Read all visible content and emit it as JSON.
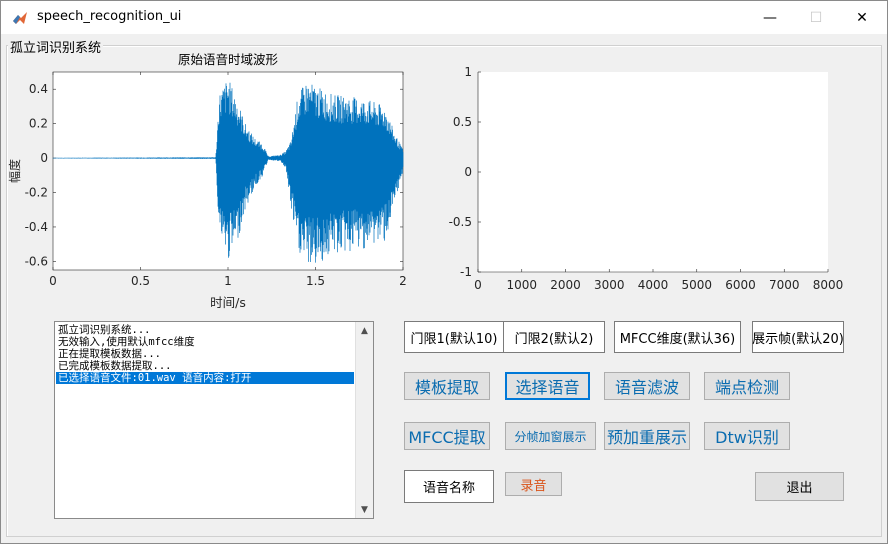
{
  "window": {
    "title": "speech_recognition_ui",
    "controls": {
      "minimize": "—",
      "maximize": "☐",
      "close": "✕"
    }
  },
  "panel": {
    "title": "孤立词识别系统"
  },
  "left_plot": {
    "title": "原始语音时域波形",
    "xlabel": "时间/s",
    "ylabel": "幅度"
  },
  "chart_data": [
    {
      "type": "line",
      "title": "原始语音时域波形",
      "xlabel": "时间/s",
      "ylabel": "幅度",
      "xlim": [
        0,
        2
      ],
      "ylim": [
        -0.65,
        0.5
      ],
      "xticks": [
        "0",
        "0.5",
        "1",
        "1.5",
        "2"
      ],
      "yticks": [
        "0.4",
        "0.2",
        "0",
        "-0.2",
        "-0.4",
        "-0.6"
      ],
      "series": [
        {
          "color": "#0072bd",
          "envelope_x": [
            0,
            0.93,
            0.95,
            1.0,
            1.05,
            1.1,
            1.15,
            1.2,
            1.23,
            1.3,
            1.33,
            1.36,
            1.4,
            1.45,
            1.5,
            1.6,
            1.7,
            1.8,
            1.9,
            1.95,
            2.0
          ],
          "upper": [
            0.002,
            0.005,
            0.38,
            0.47,
            0.35,
            0.2,
            0.12,
            0.08,
            0.01,
            0.02,
            0.04,
            0.1,
            0.37,
            0.45,
            0.42,
            0.37,
            0.36,
            0.34,
            0.3,
            0.15,
            0.05
          ],
          "lower": [
            -0.002,
            -0.005,
            -0.45,
            -0.6,
            -0.5,
            -0.3,
            -0.18,
            -0.1,
            -0.01,
            -0.02,
            -0.06,
            -0.3,
            -0.55,
            -0.62,
            -0.63,
            -0.56,
            -0.55,
            -0.52,
            -0.48,
            -0.3,
            -0.08
          ]
        }
      ]
    },
    {
      "type": "line",
      "title": "",
      "xlim": [
        0,
        8000
      ],
      "ylim": [
        -1,
        1
      ],
      "xticks": [
        "0",
        "1000",
        "2000",
        "3000",
        "4000",
        "5000",
        "6000",
        "7000",
        "8000"
      ],
      "yticks": [
        "1",
        "0.5",
        "0",
        "-0.5",
        "-1"
      ],
      "series": []
    }
  ],
  "log_list": {
    "lines": [
      "孤立词识别系统...",
      "无效输入,使用默认mfcc维度",
      "正在提取模板数据...",
      "已完成模板数据提取...",
      "已选择语音文件:01.wav 语音内容:打开"
    ],
    "selected_index": 4
  },
  "params": {
    "threshold1": "门限1(默认10)",
    "threshold2": "门限2(默认2)",
    "mfcc_dim": "MFCC维度(默认36)",
    "show_frame": "展示帧(默认20)"
  },
  "buttons": {
    "template_extract": "模板提取",
    "select_speech": "选择语音",
    "speech_filter": "语音滤波",
    "endpoint_detect": "端点检测",
    "mfcc_extract": "MFCC提取",
    "frame_window": "分帧加窗展示",
    "pre_emphasis": "预加重展示",
    "dtw_recognize": "Dtw识别",
    "record": "录音",
    "exit": "退出"
  },
  "speech_name": {
    "value": "语音名称"
  },
  "colors": {
    "button_text": "#0a6cb0",
    "record_text": "#d9541a",
    "waveform": "#0072bd",
    "selection": "#0078d7"
  }
}
